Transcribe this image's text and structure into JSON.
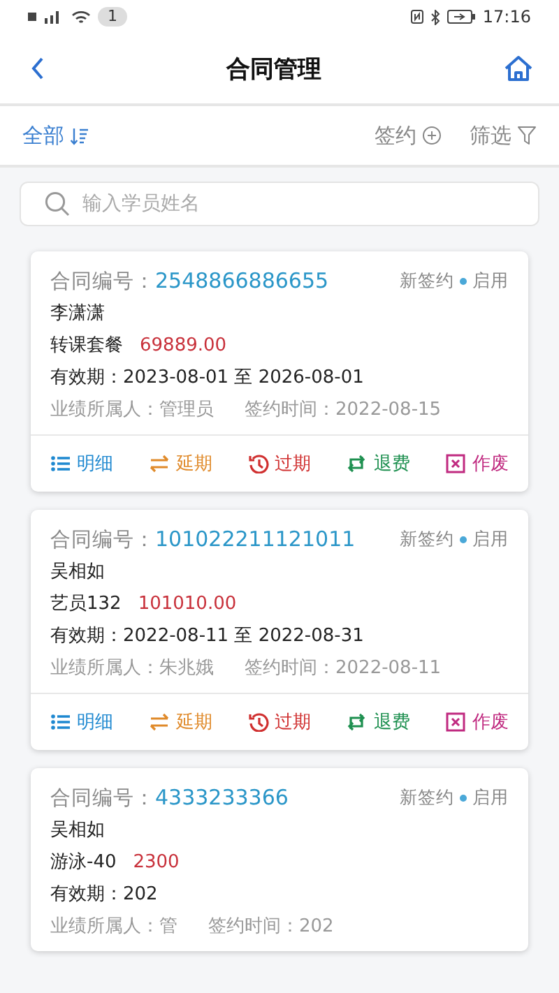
{
  "status_bar": {
    "badge": "1",
    "time": "17:16"
  },
  "header": {
    "title": "合同管理"
  },
  "filter_bar": {
    "scope": "全部",
    "sign": "签约",
    "filter": "筛选"
  },
  "search": {
    "placeholder": "输入学员姓名"
  },
  "contracts": [
    {
      "number_label": "合同编号：",
      "number": "2548866886655",
      "type": "新签约",
      "status": "启用",
      "color": "#4aa8d8",
      "student": "李潇潇",
      "product": "转课套餐",
      "price": "69889.00",
      "validity": "有效期：2023-08-01 至 2026-08-01",
      "owner": "业绩所属人：管理员",
      "sign_time": "签约时间：2022-08-15",
      "actions": [
        {
          "kind": "detail",
          "label": "明细"
        },
        {
          "kind": "extend",
          "label": "延期"
        },
        {
          "kind": "expire",
          "label": "过期"
        },
        {
          "kind": "refund",
          "label": "退费"
        },
        {
          "kind": "void",
          "label": "作废"
        }
      ]
    },
    {
      "number_label": "合同编号：",
      "number": "101022211121011",
      "type": "新签约",
      "status": "启用",
      "color": "#4aa8d8",
      "student": "吴相如",
      "product": "艺员132",
      "price": "101010.00",
      "validity": "有效期：2022-08-11 至 2022-08-31",
      "owner": "业绩所属人：朱兆娥",
      "sign_time": "签约时间：2022-08-11",
      "actions": [
        {
          "kind": "detail",
          "label": "明细"
        },
        {
          "kind": "extend",
          "label": "延期"
        },
        {
          "kind": "expire",
          "label": "过期"
        },
        {
          "kind": "refund",
          "label": "退费"
        },
        {
          "kind": "void",
          "label": "作废"
        }
      ]
    },
    {
      "number_label": "合同编号：",
      "number": "4333233366",
      "type": "新签约",
      "status": "启用",
      "color": "#4aa8d8",
      "student": "吴相如",
      "product": "游泳-40",
      "price": "2300",
      "validity": "有效期：202",
      "owner": "业绩所属人：管",
      "sign_time": "签约时间：202"
    }
  ]
}
